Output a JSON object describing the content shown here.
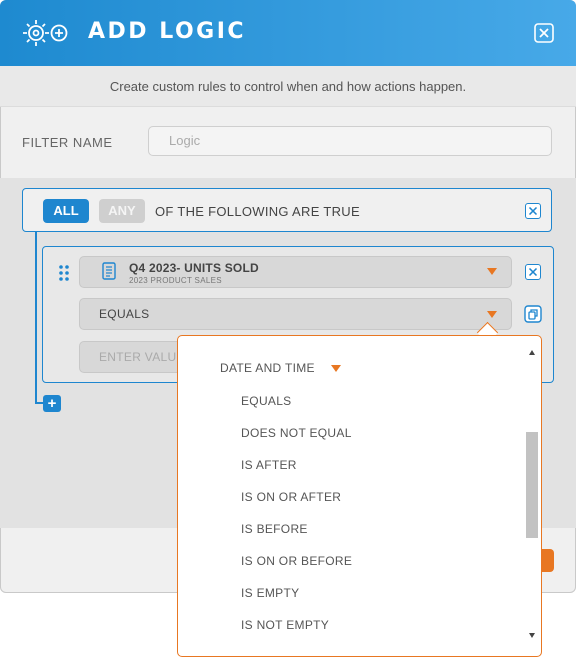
{
  "dialog": {
    "title": "ADD LOGIC",
    "subtitle": "Create custom rules to control when and how actions happen.",
    "icons": [
      "gear-bulb-icon",
      "plus-circle-icon",
      "close-icon"
    ]
  },
  "filter": {
    "label": "FILTER NAME",
    "placeholder": "Logic"
  },
  "group": {
    "all_label": "ALL",
    "any_label": "ANY",
    "condition_text": "OF THE FOLLOWING ARE TRUE"
  },
  "condition": {
    "field_name": "Q4 2023- UNITS SOLD",
    "field_source": "2023 PRODUCT SALES",
    "operator": "EQUALS",
    "value_placeholder": "ENTER VALUE"
  },
  "dropdown": {
    "group_label": "DATE AND TIME",
    "options": [
      "EQUALS",
      "DOES NOT EQUAL",
      "IS AFTER",
      "IS ON OR AFTER",
      "IS BEFORE",
      "IS ON OR BEFORE",
      "IS EMPTY",
      "IS NOT EMPTY"
    ]
  },
  "colors": {
    "primary": "#1e86cf",
    "accent": "#e87722",
    "header_gradient": [
      "#1e8ad0",
      "#47a9e8"
    ]
  }
}
